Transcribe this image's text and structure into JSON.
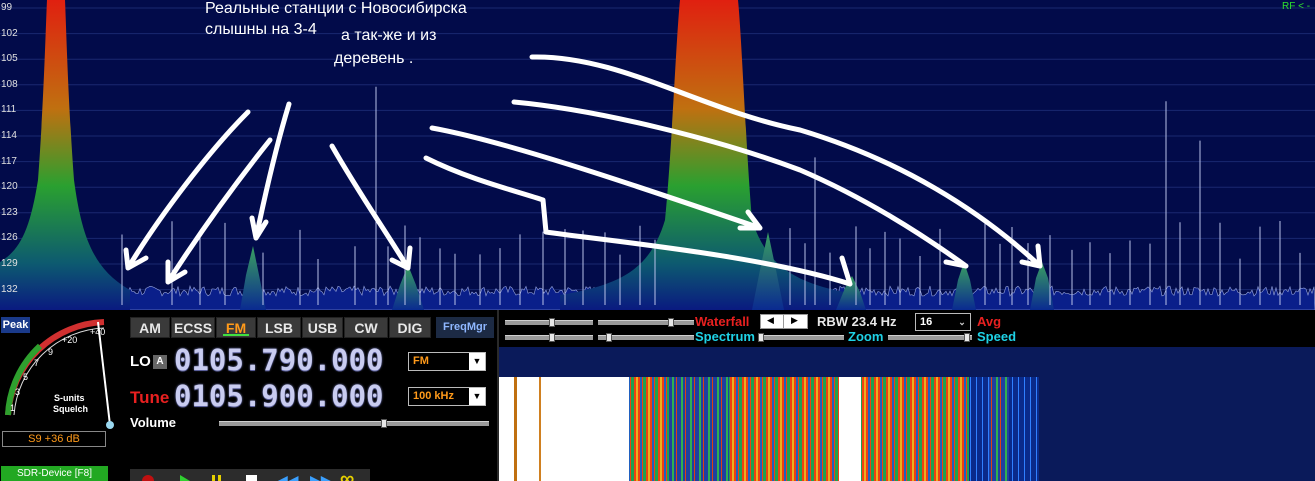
{
  "spectrum": {
    "y_ticks": [
      "99",
      "102",
      "105",
      "108",
      "111",
      "114",
      "117",
      "120",
      "123",
      "126",
      "129",
      "132"
    ],
    "rf_indicator": "RF < -",
    "annotation_line1": "Реальные станции с Новосибирска",
    "annotation_line2": "слышны на 3-4",
    "annotation_line3": "а так-же  и из",
    "annotation_line4": "деревень ."
  },
  "meter": {
    "peak_label": "Peak",
    "scale_labels": [
      "1",
      "3",
      "5",
      "7",
      "9",
      "+20",
      "+40"
    ],
    "s_units_label": "S-units",
    "squelch_label": "Squelch",
    "reading": "S9 +36 dB",
    "device_button": "SDR-Device [F8]"
  },
  "modes": {
    "items": [
      "AM",
      "ECSS",
      "FM",
      "LSB",
      "USB",
      "CW",
      "DIG"
    ],
    "active": "FM",
    "freqmgr": "FreqMgr"
  },
  "lo": {
    "label": "LO",
    "lock_label": "A",
    "frequency": "0105.790.000",
    "mode_select": "FM"
  },
  "tune": {
    "label": "Tune",
    "frequency": "0105.900.000",
    "step_select": "100 kHz"
  },
  "volume": {
    "label": "Volume",
    "level_percent": 61
  },
  "controls": {
    "waterfall_label": "Waterfall",
    "rbw_label": "RBW 23.4 Hz",
    "avg_value": "16",
    "avg_label": "Avg",
    "spectrum_label": "Spectrum",
    "zoom_label": "Zoom",
    "speed_label": "Speed"
  },
  "colors": {
    "background": "#000000",
    "spectrum_bg": "#020b4a",
    "accent_red": "#e82020",
    "accent_cyan": "#1fd2e6",
    "accent_orange": "#ff9a1a",
    "freq_digits": "#c9ccf0"
  }
}
